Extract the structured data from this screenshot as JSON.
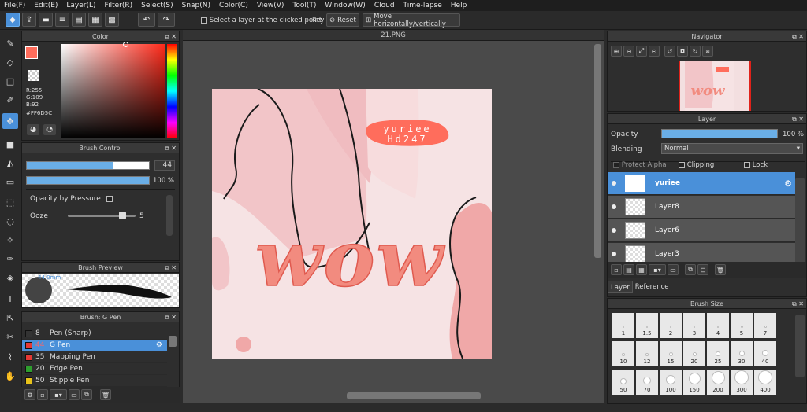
{
  "menu": [
    "File(F)",
    "Edit(E)",
    "Layer(L)",
    "Filter(R)",
    "Select(S)",
    "Snap(N)",
    "Color(C)",
    "View(V)",
    "Tool(T)",
    "Window(W)",
    "Cloud",
    "Time-lapse",
    "Help"
  ],
  "toolbar": {
    "select_layer_label": "Select a layer at the clicked point",
    "key_label": "Key",
    "reset_label": "Reset",
    "move_label": "Move horizontally/vertically"
  },
  "color_panel": {
    "title": "Color",
    "r": "R:255",
    "g": "G:109",
    "b": "B:92",
    "hex": "#FF6D5C",
    "fg_color": "#ff6d5c"
  },
  "brush_control": {
    "title": "Brush Control",
    "size_value": "44",
    "size_fraction": 0.7,
    "opacity_value": "100 %",
    "opacity_fraction": 1.0,
    "opacity_by_pressure": "Opacity by Pressure",
    "ooze_label": "Ooze",
    "ooze_value": "5",
    "ooze_fraction": 0.8
  },
  "brush_preview": {
    "title": "Brush Preview",
    "size_label": "44.0mm"
  },
  "brush_list": {
    "title": "Brush: G Pen",
    "items": [
      {
        "num": "8",
        "name": "Pen (Sharp)",
        "color": "#333333"
      },
      {
        "num": "44",
        "name": "G Pen",
        "color": "#e53935",
        "selected": true
      },
      {
        "num": "35",
        "name": "Mapping Pen",
        "color": "#e53935"
      },
      {
        "num": "20",
        "name": "Edge Pen",
        "color": "#2e9e2e"
      },
      {
        "num": "50",
        "name": "Stipple Pen",
        "color": "#e8c21a"
      }
    ]
  },
  "canvas": {
    "tab_title": "21.PNG",
    "art_text_top": "yuriee",
    "art_text_bottom": "Hd247",
    "art_word": "wow"
  },
  "navigator": {
    "title": "Navigator"
  },
  "layer_panel": {
    "title": "Layer",
    "opacity_label": "Opacity",
    "opacity_value": "100 %",
    "blending_label": "Blending",
    "blending_value": "Normal",
    "protect_alpha": "Protect Alpha",
    "clipping": "Clipping",
    "lock": "Lock",
    "layers": [
      {
        "name": "yuriee",
        "selected": true
      },
      {
        "name": "Layer8",
        "selected": false
      },
      {
        "name": "Layer6",
        "selected": false
      },
      {
        "name": "Layer3",
        "selected": false
      }
    ],
    "tab_layer": "Layer",
    "tab_reference": "Reference"
  },
  "brush_size": {
    "title": "Brush Size",
    "sizes": [
      "1",
      "1.5",
      "2",
      "3",
      "4",
      "5",
      "7",
      "10",
      "12",
      "15",
      "20",
      "25",
      "30",
      "40",
      "50",
      "70",
      "100",
      "150",
      "200",
      "300",
      "400"
    ]
  }
}
